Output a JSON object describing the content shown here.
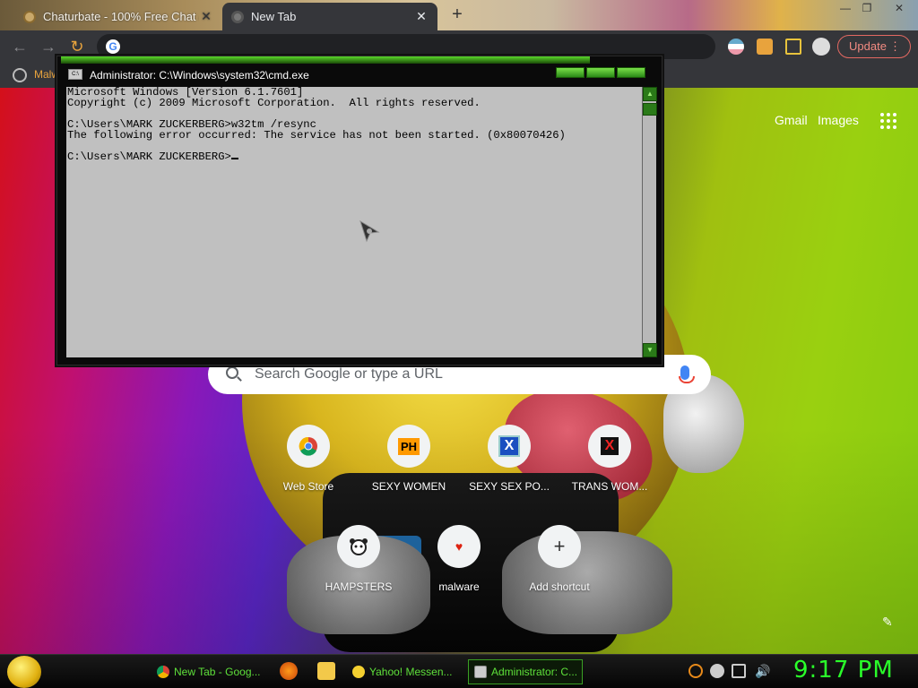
{
  "browser": {
    "tabs": [
      {
        "title": "Chaturbate - 100% Free Chat &",
        "close": "✕"
      },
      {
        "title": "New Tab",
        "close": "✕"
      }
    ],
    "new_tab_symbol": "+",
    "window_controls": [
      "—",
      "❐",
      "✕"
    ],
    "nav": {
      "back": "←",
      "forward": "→",
      "reload": "↻"
    },
    "omnibox_logo": "G",
    "update_label": "Update",
    "update_menu": "⋮",
    "bookmarks_label": "Malw"
  },
  "ntp": {
    "gmail": "Gmail",
    "images": "Images",
    "search_placeholder": "Search Google or type a URL",
    "shortcuts": [
      {
        "label": "Web Store",
        "icon": "chrome-icon"
      },
      {
        "label": "SEXY WOMEN",
        "icon_text": "PH"
      },
      {
        "label": "SEXY SEX PO...",
        "icon_text": "X"
      },
      {
        "label": "TRANS WOM...",
        "icon_text": "X"
      },
      {
        "label": "HAMPSTERS",
        "icon": "hamster-icon"
      },
      {
        "label": "malware",
        "icon_text": "♥"
      },
      {
        "label": "Add shortcut",
        "icon_text": "+"
      }
    ],
    "edit_symbol": "✎"
  },
  "cmd": {
    "title": "Administrator: C:\\Windows\\system32\\cmd.exe",
    "icon_text": "C:\\",
    "lines": [
      "Microsoft Windows [Version 6.1.7601]",
      "Copyright (c) 2009 Microsoft Corporation.  All rights reserved.",
      "",
      "C:\\Users\\MARK ZUCKERBERG>w32tm /resync",
      "The following error occurred: The service has not been started. (0x80070426)",
      "",
      "C:\\Users\\MARK ZUCKERBERG>"
    ]
  },
  "taskbar": {
    "tasks": [
      {
        "label": "New Tab - Goog..."
      },
      {
        "label": "Yahoo! Messen..."
      },
      {
        "label": "Administrator: C..."
      }
    ],
    "clock": "9:17 PM"
  },
  "colors": {
    "chrome_dark": "#35363a",
    "update_red": "#f28b82",
    "taskbar_green": "#5ee03a",
    "clock_green": "#2aff2a",
    "cmd_background": "#c0c0c0"
  }
}
